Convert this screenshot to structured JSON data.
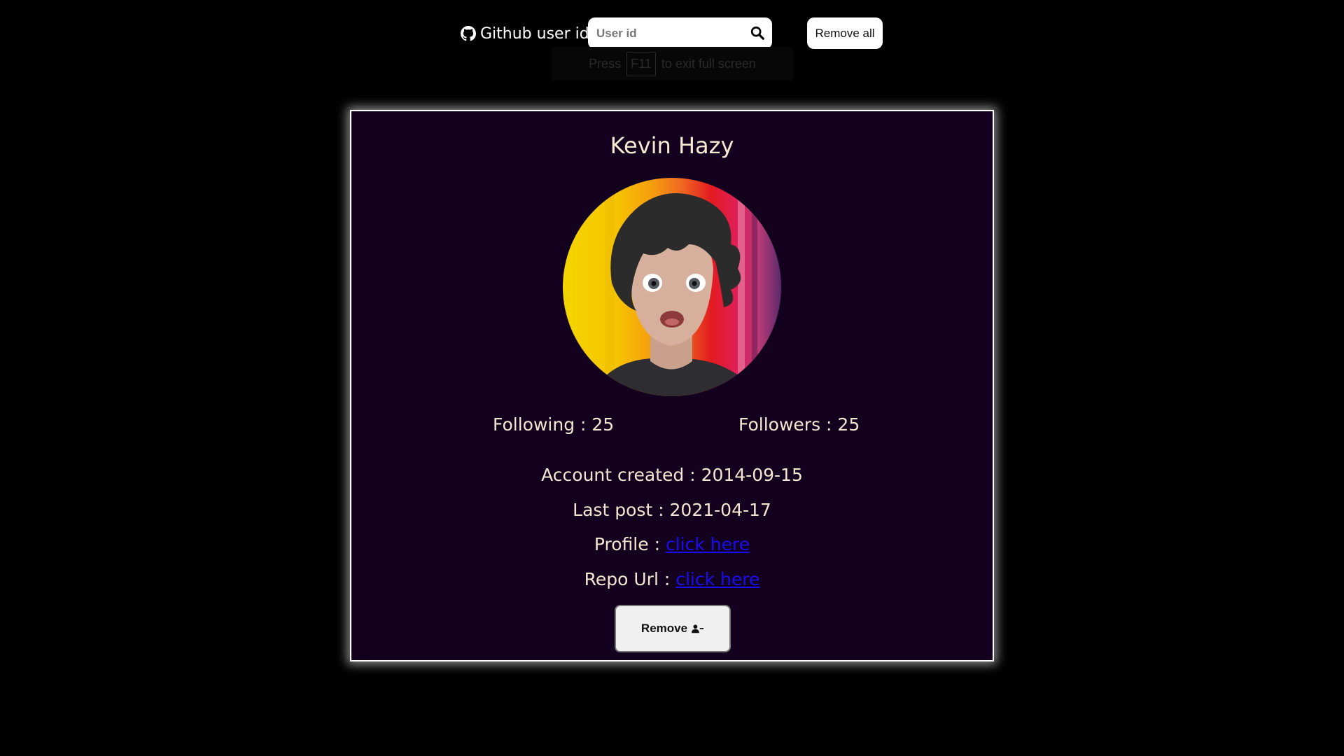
{
  "header": {
    "label": "Github user id:",
    "search": {
      "placeholder": "User id",
      "value": ""
    },
    "remove_all_label": "Remove all"
  },
  "fullscreen_hint": {
    "prefix": "Press",
    "key": "F11",
    "suffix": "to exit full screen"
  },
  "card": {
    "name": "Kevin Hazy",
    "following_label": "Following : ",
    "following": "25",
    "followers_label": "Followers : ",
    "followers": "25",
    "created_label": "Account created : ",
    "created": "2014-09-15",
    "lastpost_label": "Last post : ",
    "lastpost": "2021-04-17",
    "profile_label": "Profile : ",
    "profile_link": "click here",
    "repo_label": "Repo Url : ",
    "repo_link": "click here",
    "remove_label": "Remove"
  },
  "icons": {
    "github": "github-icon",
    "search": "search-icon",
    "remove_user": "user-minus-icon"
  },
  "colors": {
    "page_bg": "#000000",
    "card_bg": "#13001e",
    "card_text": "#f3e7cf",
    "link": "#1a0cf0"
  }
}
